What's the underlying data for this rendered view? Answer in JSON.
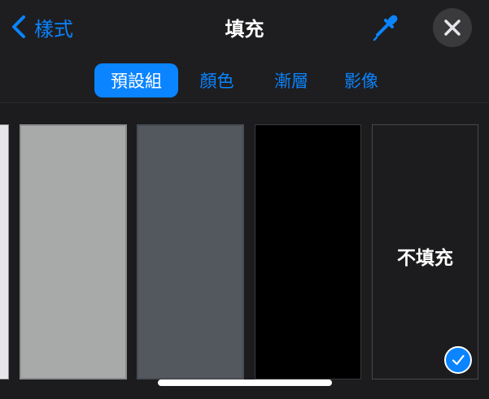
{
  "header": {
    "back_label": "樣式",
    "title": "填充"
  },
  "tabs": [
    {
      "label": "預設組",
      "active": true
    },
    {
      "label": "顏色",
      "active": false
    },
    {
      "label": "漸層",
      "active": false
    },
    {
      "label": "影像",
      "active": false
    }
  ],
  "swatches": {
    "edge_color": "#e5e5ea",
    "light_gray_color": "#a7aaa9",
    "dark_gray_color": "#53575e",
    "black_color": "#000000",
    "no_fill_label": "不填充",
    "selected": "no_fill"
  },
  "colors": {
    "accent": "#0a84ff",
    "background": "#1c1c1e"
  },
  "icons": {
    "back": "chevron-left-icon",
    "eyedropper": "eyedropper-icon",
    "close": "close-icon",
    "selected": "checkmark-icon"
  }
}
